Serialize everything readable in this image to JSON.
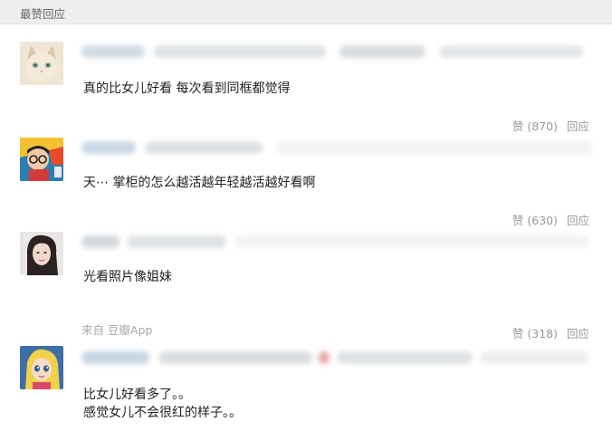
{
  "section": {
    "title": "最赞回应"
  },
  "comments": [
    {
      "text_lines": [
        "真的比女儿好看 每次看到同框都觉得"
      ],
      "like_label": "赞",
      "like_count": "(870)",
      "reply_label": "回应",
      "avatar_icon": "cat-avatar-icon"
    },
    {
      "text_lines": [
        "天⋯ 掌柜的怎么越活越年轻越活越好看啊"
      ],
      "like_label": "赞",
      "like_count": "(630)",
      "reply_label": "回应",
      "avatar_icon": "cartoon-glasses-avatar-icon"
    },
    {
      "text_lines": [
        "光看照片像姐妹"
      ],
      "source_text": "来自 豆瓣App",
      "like_label": "赞",
      "like_count": "(318)",
      "reply_label": "回应",
      "avatar_icon": "woman-portrait-avatar-icon"
    },
    {
      "text_lines": [
        "比女儿好看多了。。",
        "感觉女儿不会很红的样子。。"
      ],
      "avatar_icon": "anime-girl-avatar-icon"
    }
  ],
  "colors": {
    "header_bg": "#eeeeee",
    "text": "#222222",
    "muted": "#999999",
    "blur_gray": "#d6d9dc",
    "blur_blue": "#c5d6e4"
  }
}
